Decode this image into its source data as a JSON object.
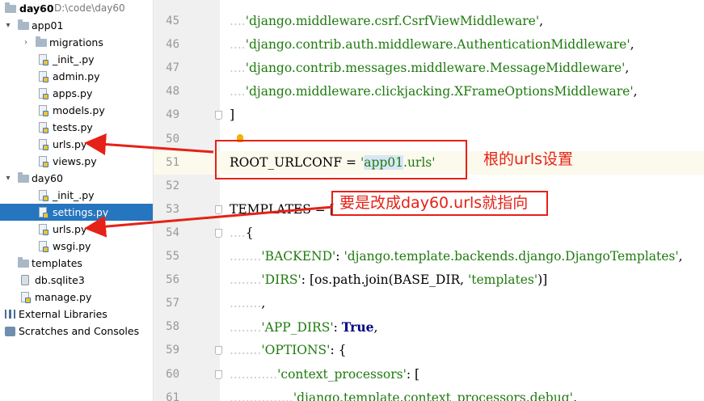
{
  "project": {
    "name": "day60",
    "path": "D:\\code\\day60",
    "tree": [
      {
        "label": "app01",
        "indent": 1,
        "type": "folder",
        "arrow": "down"
      },
      {
        "label": "migrations",
        "indent": 2,
        "type": "folder",
        "arrow": "right"
      },
      {
        "label": "_init_.py",
        "indent": 2,
        "type": "py"
      },
      {
        "label": "admin.py",
        "indent": 2,
        "type": "py"
      },
      {
        "label": "apps.py",
        "indent": 2,
        "type": "py"
      },
      {
        "label": "models.py",
        "indent": 2,
        "type": "py"
      },
      {
        "label": "tests.py",
        "indent": 2,
        "type": "py"
      },
      {
        "label": "urls.py",
        "indent": 2,
        "type": "py"
      },
      {
        "label": "views.py",
        "indent": 2,
        "type": "py"
      },
      {
        "label": "day60",
        "indent": 1,
        "type": "folder",
        "arrow": "down"
      },
      {
        "label": "_init_.py",
        "indent": 2,
        "type": "py"
      },
      {
        "label": "settings.py",
        "indent": 2,
        "type": "py",
        "selected": true
      },
      {
        "label": "urls.py",
        "indent": 2,
        "type": "py"
      },
      {
        "label": "wsgi.py",
        "indent": 2,
        "type": "py"
      },
      {
        "label": "templates",
        "indent": 1,
        "type": "folder"
      },
      {
        "label": "db.sqlite3",
        "indent": 1,
        "type": "db"
      },
      {
        "label": "manage.py",
        "indent": 1,
        "type": "py"
      },
      {
        "label": "External Libraries",
        "indent": 0,
        "type": "lib"
      },
      {
        "label": "Scratches and Consoles",
        "indent": 0,
        "type": "scratch"
      }
    ]
  },
  "editor": {
    "current_line": "51",
    "lines": [
      {
        "n": "45",
        "tokens": [
          [
            "dots",
            "...."
          ],
          [
            "str",
            "'django.middleware.csrf.CsrfViewMiddleware'"
          ],
          [
            "",
            ","
          ]
        ]
      },
      {
        "n": "46",
        "tokens": [
          [
            "dots",
            "...."
          ],
          [
            "str",
            "'django.contrib.auth.middleware.AuthenticationMiddleware'"
          ],
          [
            "",
            ","
          ]
        ]
      },
      {
        "n": "47",
        "tokens": [
          [
            "dots",
            "...."
          ],
          [
            "str",
            "'django.contrib.messages.middleware.MessageMiddleware'"
          ],
          [
            "",
            ","
          ]
        ]
      },
      {
        "n": "48",
        "tokens": [
          [
            "dots",
            "...."
          ],
          [
            "str",
            "'django.middleware.clickjacking.XFrameOptionsMiddleware'"
          ],
          [
            "",
            ","
          ]
        ]
      },
      {
        "n": "49",
        "tokens": [
          [
            "",
            "]"
          ]
        ],
        "fold": true
      },
      {
        "n": "50",
        "tokens": []
      },
      {
        "n": "51",
        "tokens": [
          [
            "",
            "ROOT_URLCONF = "
          ],
          [
            "str",
            "'"
          ],
          [
            "str hl",
            "app01"
          ],
          [
            "str",
            ".urls'"
          ]
        ]
      },
      {
        "n": "52",
        "tokens": []
      },
      {
        "n": "53",
        "tokens": [
          [
            "",
            "TEMPLATES = ["
          ]
        ],
        "fold": true
      },
      {
        "n": "54",
        "tokens": [
          [
            "dots",
            "...."
          ],
          [
            "",
            "{"
          ]
        ],
        "fold": true
      },
      {
        "n": "55",
        "tokens": [
          [
            "dots",
            "........"
          ],
          [
            "str",
            "'BACKEND'"
          ],
          [
            "",
            ": "
          ],
          [
            "str",
            "'django.template.backends.django.DjangoTemplates'"
          ],
          [
            "",
            ","
          ]
        ]
      },
      {
        "n": "56",
        "tokens": [
          [
            "dots",
            "........"
          ],
          [
            "str",
            "'DIRS'"
          ],
          [
            "",
            ": [os.path.join(BASE_DIR, "
          ],
          [
            "str",
            "'templates'"
          ],
          [
            "",
            ")]"
          ]
        ]
      },
      {
        "n": "57",
        "tokens": [
          [
            "dots",
            "........"
          ],
          [
            "",
            ","
          ]
        ]
      },
      {
        "n": "58",
        "tokens": [
          [
            "dots",
            "........"
          ],
          [
            "str",
            "'APP_DIRS'"
          ],
          [
            "",
            ": "
          ],
          [
            "kw",
            "True"
          ],
          [
            "",
            ","
          ]
        ]
      },
      {
        "n": "59",
        "tokens": [
          [
            "dots",
            "........"
          ],
          [
            "str",
            "'OPTIONS'"
          ],
          [
            "",
            ": {"
          ]
        ],
        "fold": true
      },
      {
        "n": "60",
        "tokens": [
          [
            "dots",
            "............"
          ],
          [
            "str",
            "'context_processors'"
          ],
          [
            "",
            ": ["
          ]
        ],
        "fold": true
      },
      {
        "n": "61",
        "tokens": [
          [
            "dots",
            "................"
          ],
          [
            "str",
            "'django.template.context_processors.debug'"
          ],
          [
            "",
            ","
          ]
        ]
      }
    ]
  },
  "annotations": {
    "note1": "根的urls设置",
    "note2": "要是改成day60.urls就指向",
    "color": "#e62117"
  },
  "colors": {
    "selection": "#2675bf",
    "string": "#1f7a0f",
    "keyword": "#000080"
  }
}
